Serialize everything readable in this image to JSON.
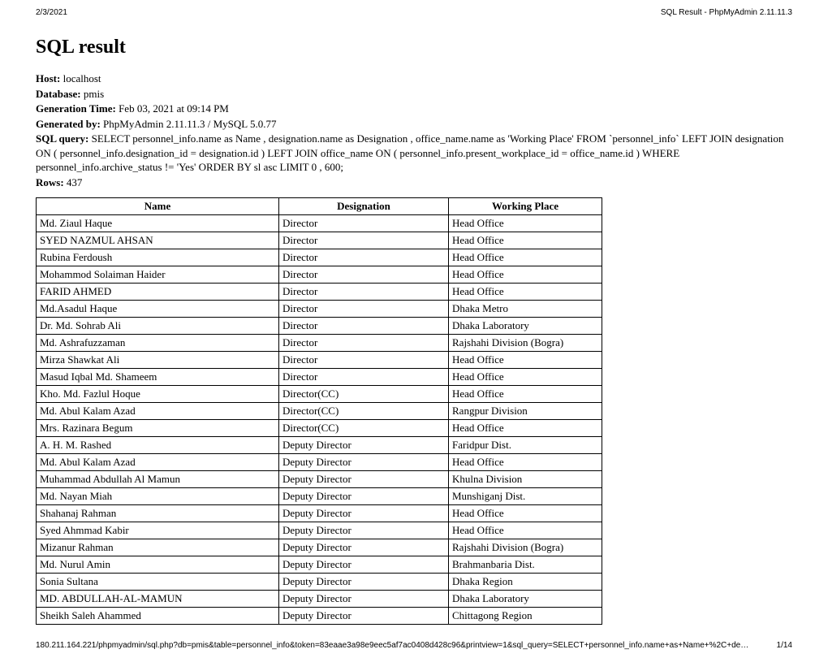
{
  "header": {
    "date": "2/3/2021",
    "title": "SQL Result - PhpMyAdmin 2.11.11.3"
  },
  "page_title": "SQL result",
  "meta": {
    "host_label": "Host:",
    "host": "localhost",
    "database_label": "Database:",
    "database": "pmis",
    "gentime_label": "Generation Time:",
    "gentime": "Feb 03, 2021 at 09:14 PM",
    "genby_label": "Generated by:",
    "genby": "PhpMyAdmin 2.11.11.3 / MySQL 5.0.77",
    "sqlquery_label": "SQL query:",
    "sqlquery": "SELECT personnel_info.name as Name , designation.name as Designation , office_name.name as 'Working Place' FROM `personnel_info` LEFT JOIN designation ON ( personnel_info.designation_id = designation.id ) LEFT JOIN office_name ON ( personnel_info.present_workplace_id = office_name.id ) WHERE personnel_info.archive_status != 'Yes' ORDER BY sl asc LIMIT 0 , 600;",
    "rows_label": "Rows:",
    "rows": "437"
  },
  "table": {
    "headers": [
      "Name",
      "Designation",
      "Working Place"
    ],
    "rows": [
      [
        "Md. Ziaul Haque",
        "Director",
        "Head Office"
      ],
      [
        "SYED NAZMUL AHSAN",
        "Director",
        "Head Office"
      ],
      [
        "Rubina Ferdoush",
        "Director",
        "Head Office"
      ],
      [
        "Mohammod Solaiman Haider",
        "Director",
        "Head Office"
      ],
      [
        "FARID AHMED",
        "Director",
        "Head Office"
      ],
      [
        "Md.Asadul Haque",
        "Director",
        "Dhaka Metro"
      ],
      [
        "Dr. Md. Sohrab Ali",
        "Director",
        "Dhaka Laboratory"
      ],
      [
        "Md. Ashrafuzzaman",
        "Director",
        "Rajshahi Division (Bogra)"
      ],
      [
        "Mirza Shawkat Ali",
        "Director",
        "Head Office"
      ],
      [
        "Masud Iqbal Md. Shameem",
        "Director",
        "Head Office"
      ],
      [
        "Kho. Md. Fazlul Hoque",
        "Director(CC)",
        "Head Office"
      ],
      [
        "Md. Abul Kalam Azad",
        "Director(CC)",
        "Rangpur Division"
      ],
      [
        "Mrs. Razinara Begum",
        "Director(CC)",
        "Head Office"
      ],
      [
        "A. H. M. Rashed",
        "Deputy Director",
        "Faridpur Dist."
      ],
      [
        "Md. Abul Kalam Azad",
        "Deputy Director",
        "Head Office"
      ],
      [
        "Muhammad Abdullah Al Mamun",
        "Deputy Director",
        "Khulna Division"
      ],
      [
        "Md. Nayan Miah",
        "Deputy Director",
        "Munshiganj Dist."
      ],
      [
        "Shahanaj Rahman",
        "Deputy Director",
        "Head Office"
      ],
      [
        "Syed Ahmmad Kabir",
        "Deputy Director",
        "Head Office"
      ],
      [
        "Mizanur Rahman",
        "Deputy Director",
        "Rajshahi Division (Bogra)"
      ],
      [
        "Md. Nurul Amin",
        "Deputy Director",
        "Brahmanbaria Dist."
      ],
      [
        "Sonia Sultana",
        "Deputy Director",
        "Dhaka Region"
      ],
      [
        "MD. ABDULLAH-AL-MAMUN",
        "Deputy Director",
        "Dhaka Laboratory"
      ],
      [
        "Sheikh Saleh Ahammed",
        "Deputy Director",
        "Chittagong Region"
      ]
    ]
  },
  "footer": {
    "url": "180.211.164.221/phpmyadmin/sql.php?db=pmis&table=personnel_info&token=83eaae3a98e9eec5af7ac0408d428c96&printview=1&sql_query=SELECT+personnel_info.name+as+Name+%2C+desig…",
    "page": "1/14"
  }
}
